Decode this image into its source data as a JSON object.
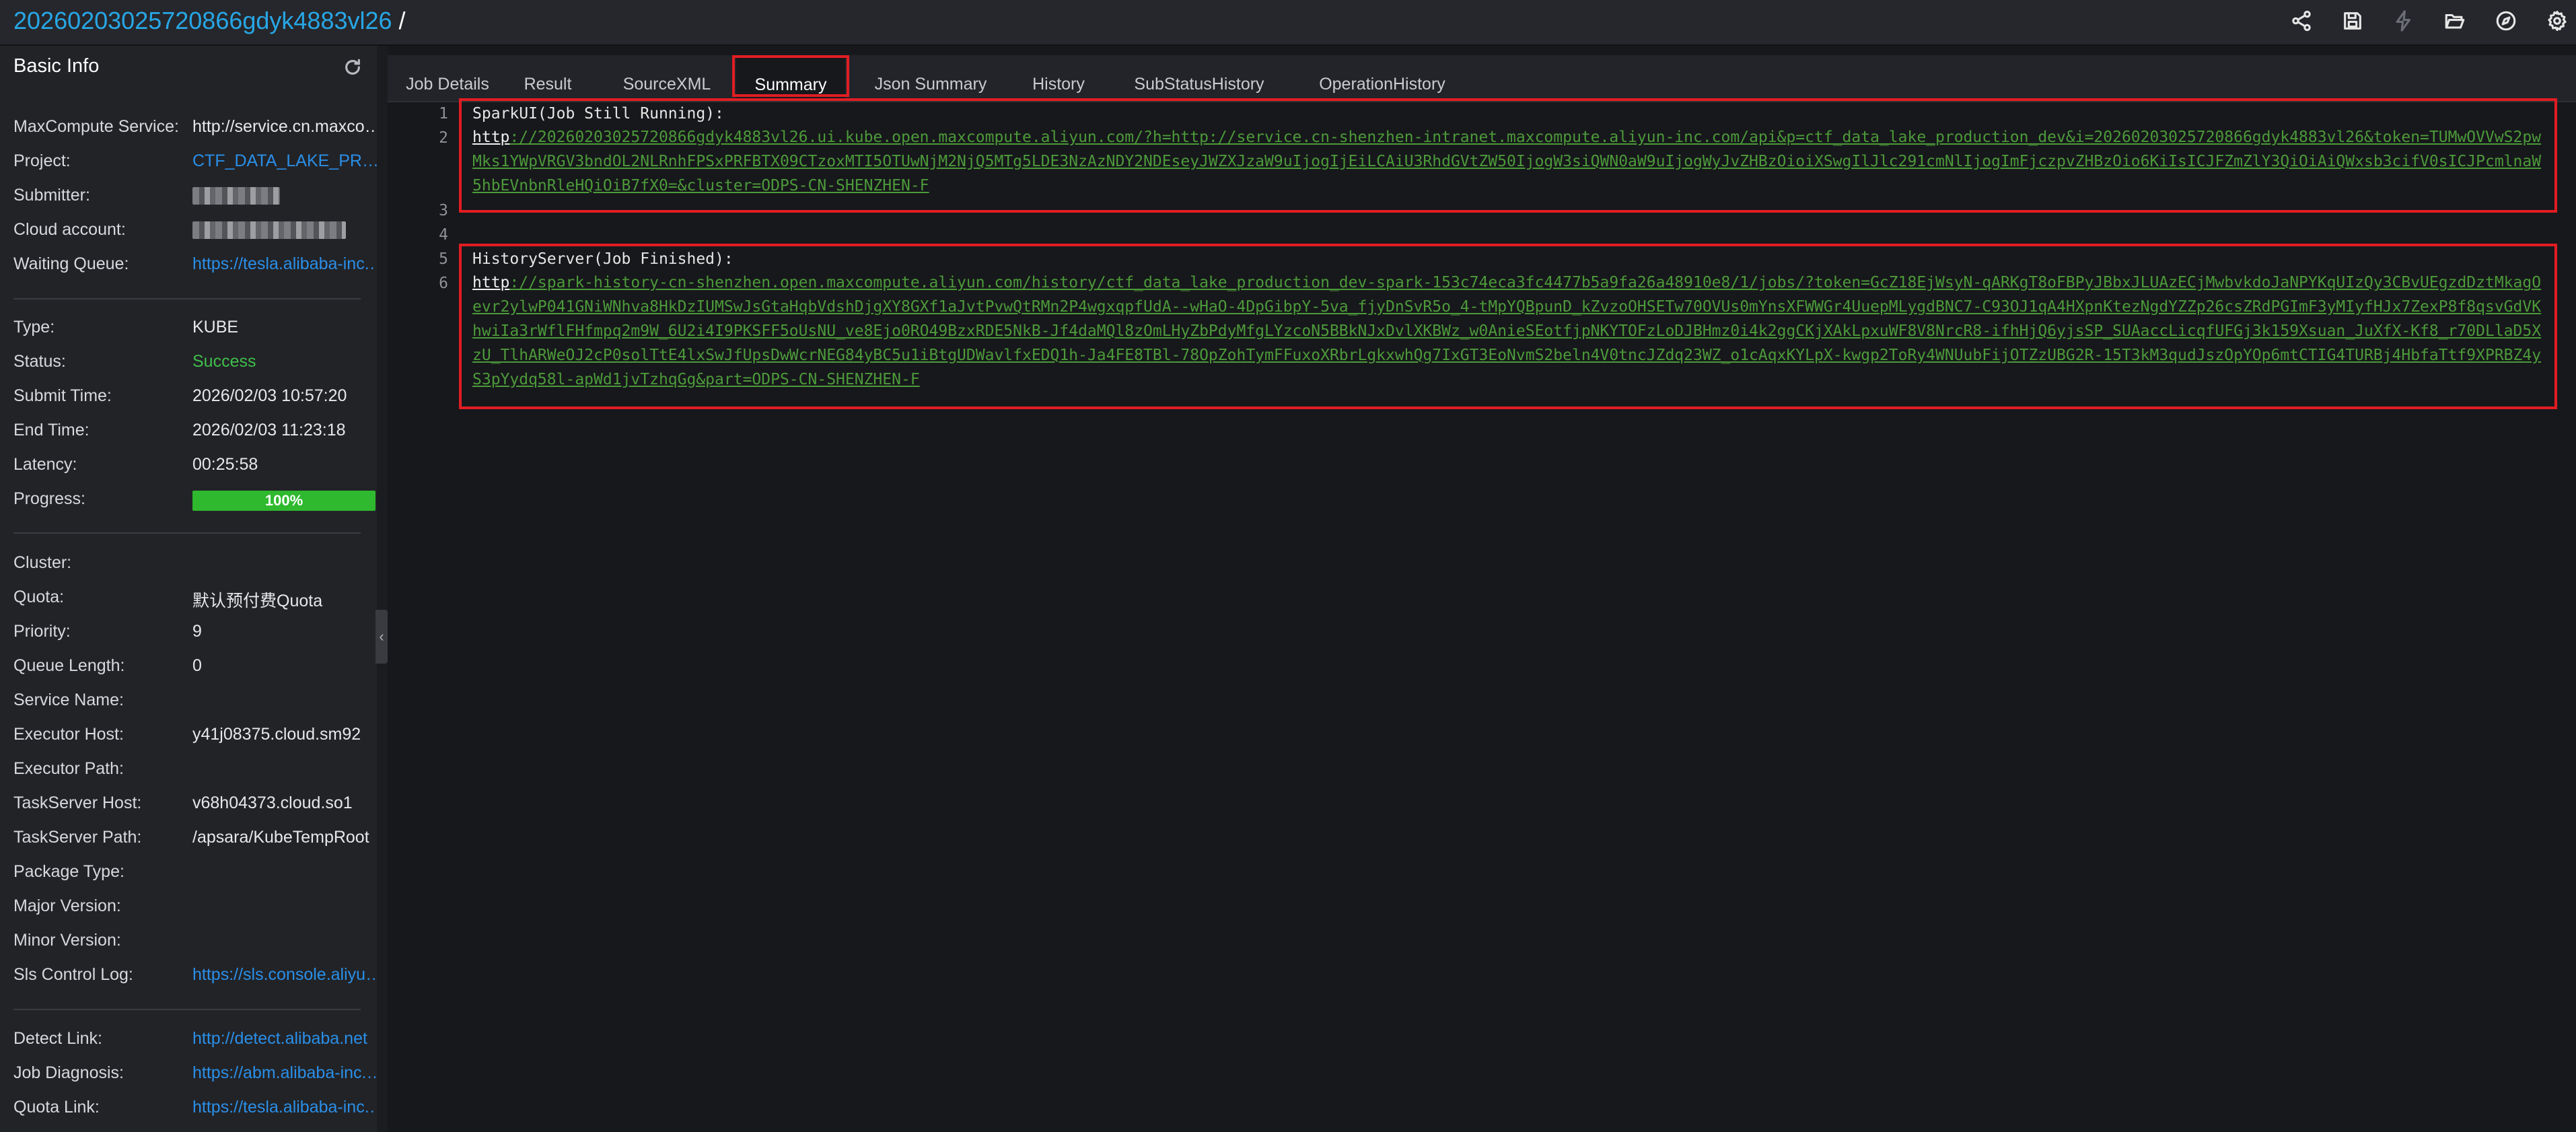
{
  "header": {
    "job_id": "20260203025720866gdyk4883vl26",
    "separator": "/",
    "icons": [
      "share-icon",
      "save-icon",
      "lightning-icon",
      "folder-open-icon",
      "compass-icon",
      "gear-icon"
    ]
  },
  "sidebar": {
    "title": "Basic Info",
    "group1": [
      {
        "key": "MaxCompute Service:",
        "value": "http://service.cn.maxcompute.aliyun-inc.com/api",
        "style": "plain"
      },
      {
        "key": "Project:",
        "value": "CTF_DATA_LAKE_PRODUCTION_DEV",
        "style": "link"
      },
      {
        "key": "Submitter:",
        "value": "",
        "style": "redacted"
      },
      {
        "key": "Cloud account:",
        "value": "",
        "style": "redacted"
      },
      {
        "key": "Waiting Queue:",
        "value": "https://tesla.alibaba-inc.com",
        "style": "link"
      }
    ],
    "group2": [
      {
        "key": "Type:",
        "value": "KUBE",
        "style": "plain"
      },
      {
        "key": "Status:",
        "value": "Success",
        "style": "ok"
      },
      {
        "key": "Submit Time:",
        "value": "2026/02/03 10:57:20",
        "style": "plain"
      },
      {
        "key": "End Time:",
        "value": "2026/02/03 11:23:18",
        "style": "plain"
      },
      {
        "key": "Latency:",
        "value": "00:25:58",
        "style": "plain"
      },
      {
        "key": "Progress:",
        "value": "",
        "style": "plain"
      }
    ],
    "progress": {
      "label": "100%",
      "fraction": 1.0
    },
    "group3": [
      {
        "key": "Cluster:",
        "value": "",
        "style": "plain"
      },
      {
        "key": "Quota:",
        "value": "默认预付费Quota",
        "style": "plain"
      },
      {
        "key": "Priority:",
        "value": "9",
        "style": "plain"
      },
      {
        "key": "Queue Length:",
        "value": "0",
        "style": "plain"
      },
      {
        "key": "Service Name:",
        "value": "",
        "style": "plain"
      },
      {
        "key": "Executor Host:",
        "value": "y41j08375.cloud.sm92",
        "style": "plain"
      },
      {
        "key": "Executor Path:",
        "value": "",
        "style": "plain"
      },
      {
        "key": "TaskServer Host:",
        "value": "v68h04373.cloud.so1",
        "style": "plain"
      },
      {
        "key": "TaskServer Path:",
        "value": "/apsara/KubeTempRoot",
        "style": "plain"
      },
      {
        "key": "Package Type:",
        "value": "",
        "style": "plain"
      },
      {
        "key": "Major Version:",
        "value": "",
        "style": "plain"
      },
      {
        "key": "Minor Version:",
        "value": "",
        "style": "plain"
      },
      {
        "key": "Sls Control Log:",
        "value": "https://sls.console.aliyun.com",
        "style": "link"
      }
    ],
    "group4": [
      {
        "key": "Detect Link:",
        "value": "http://detect.alibaba.net",
        "style": "link"
      },
      {
        "key": "Job Diagnosis:",
        "value": "https://abm.alibaba-inc.com",
        "style": "link"
      },
      {
        "key": "Quota Link:",
        "value": "https://tesla.alibaba-inc.com",
        "style": "link"
      }
    ]
  },
  "tabs": [
    "Job Details",
    "Result",
    "SourceXML",
    "Summary",
    "Json Summary",
    "History",
    "SubStatusHistory",
    "OperationHistory"
  ],
  "active_tab": "Summary",
  "editor": {
    "line1": "SparkUI(Job Still Running):",
    "line2_proto": "http",
    "line2_rest": "://20260203025720866gdyk4883vl26.ui.kube.open.maxcompute.aliyun.com/?h=http://service.cn-shenzhen-intranet.maxcompute.aliyun-inc.com/api&p=ctf_data_lake_production_dev&i=20260203025720866gdyk4883vl26&token=TUMwOVVwS2pwMks1YWpVRGV3bndOL2NLRnhFPSxPRFBTX09CTzoxMTI5OTUwNjM2NjQ5MTg5LDE3NzAzNDY2NDEseyJWZXJzaW9uIjogIjEiLCAiU3RhdGVtZW50IjogW3siQWN0aW9uIjogWyJvZHBzOioiXSwgIlJlc291cmNlIjogImFjczpvZHBzOio6KiIsICJFZmZlY3QiOiAiQWxsb3cifV0sICJPcmlnaW5hbEVnbnRleHQiOiB7fX0=&cluster=ODPS-CN-SHENZHEN-F",
    "line5": "HistoryServer(Job Finished):",
    "line6_proto": "http",
    "line6_rest": "://spark-history-cn-shenzhen.open.maxcompute.aliyun.com/history/ctf_data_lake_production_dev-spark-153c74eca3fc4477b5a9fa26a48910e8/1/jobs/?token=GcZ18EjWsyN-qARKgT8oFBPyJBbxJLUAzECjMwbvkdoJaNPYKqUIzQy3CBvUEgzdDztMkagOevr2ylwP041GNiWNhva8HkDzIUMSwJsGtaHqbVdshDjgXY8GXf1aJvtPvwQtRMn2P4wgxqpfUdA--wHaO-4DpGibpY-5va_fjyDnSvR5o_4-tMpYQBpunD_kZvzoOHSETw70OVUs0mYnsXFWWGr4UuepMLygdBNC7-C93OJ1qA4HXpnKtezNgdYZZp26csZRdPGImF3yMIyfHJx7ZexP8f8qsvGdVKhwiIa3rWflFHfmpq2m9W_6U2i4I9PKSFF5oUsNU_ve8Ejo0RO49BzxRDE5NkB-Jf4daMQl8zOmLHyZbPdyMfgLYzcoN5BBkNJxDvlXKBWz_w0AnieSEotfjpNKYTOFzLoDJBHmz0i4k2ggCKjXAkLpxuWF8V8NrcR8-ifhHjQ6yjsSP_SUAaccLicqfUFGj3k159Xsuan_JuXfX-Kf8_r70DLlaD5XzU_TlhARWeOJ2cP0solTtE4lxSwJfUpsDwWcrNEG84yBC5u1iBtgUDWavlfxEDQ1h-Ja4FE8TBl-78OpZohTymFFuxoXRbrLgkxwhQg7IxGT3EoNvmS2beln4V0tncJZdq23WZ_o1cAqxKYLpX-kwgp2ToRy4WNUubFijOTZzUBG2R-15T3kM3qudJszOpYOp6mtCTIG4TURBj4HbfaTtf9XPRBZ4yS3pYydq58l-apWd1jvTzhqGg&part=ODPS-CN-SHENZHEN-F"
  },
  "colors": {
    "accent": "#27a7e6",
    "link": "#2a8fe8",
    "success": "#3fbf4b",
    "highlight_box": "#e11d23",
    "code_green": "#4c9a3a"
  }
}
